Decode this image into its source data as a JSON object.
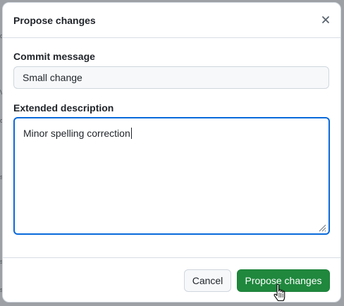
{
  "dialog": {
    "title": "Propose changes",
    "close_icon": "close-icon"
  },
  "commit": {
    "label": "Commit message",
    "value": "Small change"
  },
  "description": {
    "label": "Extended description",
    "value": "Minor spelling correction"
  },
  "footer": {
    "cancel_label": "Cancel",
    "propose_label": "Propose changes"
  },
  "colors": {
    "primary_button": "#1f883d",
    "focus_border": "#0969da"
  },
  "background": {
    "edge_letters": [
      "d",
      "V",
      "o",
      "s",
      "s",
      "s"
    ]
  }
}
